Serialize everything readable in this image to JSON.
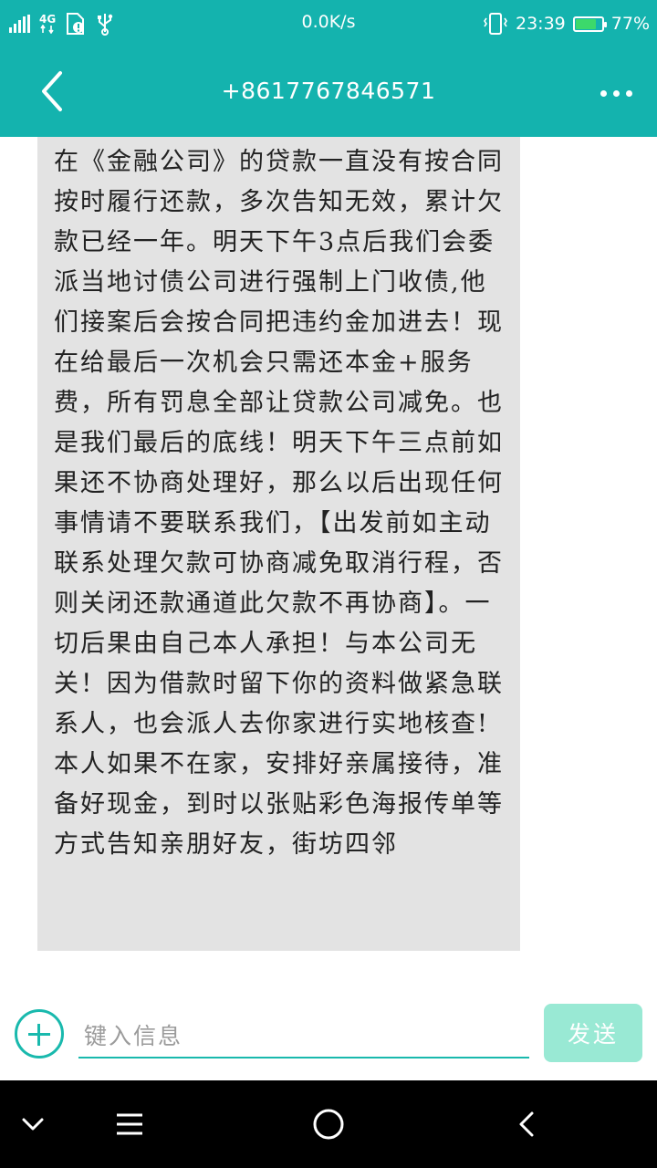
{
  "status_bar": {
    "network_type": "4G",
    "speed": "0.0K/s",
    "time": "23:39",
    "battery_percent": "77%",
    "battery_level": 0.77,
    "icons": [
      "signal-icon",
      "network-4g-icon",
      "sim-alert-icon",
      "usb-icon",
      "vibrate-icon",
      "battery-icon"
    ]
  },
  "header": {
    "title": "+8617767846571"
  },
  "message": {
    "text": "在《金融公司》的贷款一直没有按合同按时履行还款，多次告知无效，累计欠款已经一年。明天下午3点后我们会委派当地讨债公司进行强制上门收债,他们接案后会按合同把违约金加进去！现在给最后一次机会只需还本金+服务费，所有罚息全部让贷款公司减免。也是我们最后的底线！明天下午三点前如果还不协商处理好，那么以后出现任何事情请不要联系我们，【出发前如主动联系处理欠款可协商减免取消行程，否则关闭还款通道此欠款不再协商】。一切后果由自己本人承担！与本公司无关！因为借款时留下你的资料做紧急联系人，也会派人去你家进行实地核查!本人如果不在家，安排好亲属接待，准备好现金，到时以张贴彩色海报传单等方式告知亲朋好友，街坊四邻"
  },
  "composer": {
    "placeholder": "键入信息",
    "send_label": "发送"
  },
  "colors": {
    "accent": "#14b3ae",
    "send_disabled": "#99e9d4",
    "bubble": "#e3e3e3"
  }
}
